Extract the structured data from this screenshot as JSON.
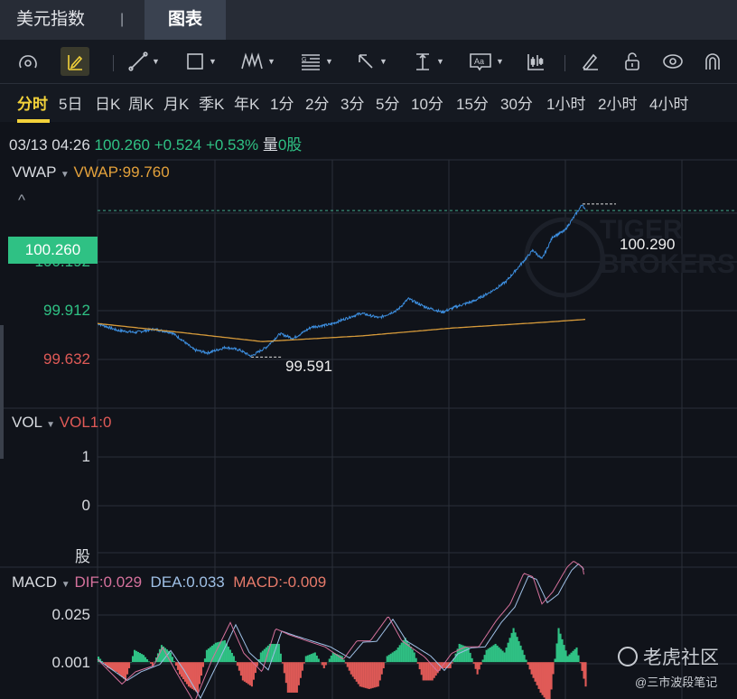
{
  "header": {
    "tabs": [
      {
        "label": "美元指数"
      },
      {
        "label": "图表"
      }
    ],
    "separator": "|",
    "active_tab": "图表"
  },
  "toolbar": {
    "tools": [
      "gauge-icon",
      "draw-edit-icon",
      "trendline-icon",
      "rectangle-icon",
      "pattern-icon",
      "fibonacci-icon",
      "arrow-icon",
      "measure-icon",
      "text-icon",
      "candle-style-icon",
      "pen-icon",
      "unlock-icon",
      "eye-icon",
      "magnet-icon"
    ]
  },
  "periods": {
    "items": [
      "分时",
      "5日",
      "日K",
      "周K",
      "月K",
      "季K",
      "年K",
      "1分",
      "2分",
      "3分",
      "5分",
      "10分",
      "15分",
      "30分",
      "1小时",
      "2小时",
      "4小时"
    ],
    "active": "分时"
  },
  "quote": {
    "datetime": "03/13 04:26",
    "price": "100.260",
    "change": "+0.524",
    "change_pct": "+0.53%",
    "volume_label": "量",
    "volume": "0股"
  },
  "main_panel": {
    "indicator": "VWAP",
    "vwap_value": "VWAP:99.760",
    "collapse": "^",
    "current_price_tag": "100.260",
    "high_label": "100.290",
    "low_label": "99.591",
    "watermark": "TIGER BROKERS"
  },
  "volume_panel": {
    "indicator": "VOL",
    "value": "VOL1:0",
    "ticks": [
      "1",
      "0",
      "股"
    ]
  },
  "macd_panel": {
    "indicator": "MACD",
    "dif": "DIF:0.029",
    "dea": "DEA:0.033",
    "macd": "MACD:-0.009",
    "ticks": [
      "0.025",
      "0.001"
    ]
  },
  "watermark": {
    "brand": "老虎社区",
    "author": "@三市波段笔记"
  },
  "colors": {
    "up": "#2fc184",
    "down": "#e05a57",
    "price_line": "#3d8fe0",
    "vwap": "#d69a3a",
    "dif": "#d5719c",
    "dea": "#9fc0e6",
    "accent": "#f3d23a"
  },
  "chart_data": [
    {
      "type": "line",
      "title": "美元指数 分时",
      "y_ticks": [
        100.192,
        99.912,
        99.632
      ],
      "ylim": [
        99.352,
        100.472
      ],
      "xlim_hours": [
        0,
        23.6
      ],
      "series": [
        {
          "name": "price",
          "points": [
            [
              0,
              99.741
            ],
            [
              0.73,
              99.71
            ],
            [
              1.4,
              99.7
            ],
            [
              2.07,
              99.715
            ],
            [
              2.73,
              99.7
            ],
            [
              3.07,
              99.67
            ],
            [
              3.57,
              99.62
            ],
            [
              4.07,
              99.606
            ],
            [
              4.73,
              99.632
            ],
            [
              5.23,
              99.62
            ],
            [
              5.67,
              99.591
            ],
            [
              6.23,
              99.632
            ],
            [
              6.73,
              99.694
            ],
            [
              7.23,
              99.673
            ],
            [
              7.9,
              99.725
            ],
            [
              8.57,
              99.736
            ],
            [
              9.23,
              99.767
            ],
            [
              9.73,
              99.788
            ],
            [
              10.4,
              99.767
            ],
            [
              11.07,
              99.803
            ],
            [
              11.47,
              99.855
            ],
            [
              12.07,
              99.818
            ],
            [
              12.73,
              99.793
            ],
            [
              13.23,
              99.818
            ],
            [
              13.9,
              99.845
            ],
            [
              14.57,
              99.891
            ],
            [
              15.07,
              99.933
            ],
            [
              15.57,
              100.005
            ],
            [
              16.07,
              100.078
            ],
            [
              16.4,
              100.036
            ],
            [
              16.8,
              100.14
            ],
            [
              17.23,
              100.166
            ],
            [
              17.57,
              100.228
            ],
            [
              17.9,
              100.29
            ],
            [
              18,
              100.26
            ]
          ]
        },
        {
          "name": "VWAP",
          "points": [
            [
              0,
              99.741
            ],
            [
              3.07,
              99.7
            ],
            [
              6.07,
              99.658
            ],
            [
              9.73,
              99.684
            ],
            [
              13.07,
              99.72
            ],
            [
              16.4,
              99.746
            ],
            [
              18,
              99.76
            ]
          ]
        }
      ],
      "high": 100.29,
      "low": 99.591,
      "last": 100.26
    },
    {
      "type": "bar",
      "title": "VOL",
      "y_ticks": [
        1,
        0
      ],
      "values": [
        0
      ]
    },
    {
      "type": "line",
      "title": "MACD",
      "y_ticks": [
        0.025,
        0.001
      ],
      "ylim": [
        -0.0133,
        0.0343
      ],
      "xlim_hours": [
        0,
        23.6
      ],
      "histogram_step_hours": 0.333,
      "histogram": [
        0.002,
        -0.002,
        -0.0035,
        -0.0066,
        0.0044,
        0.0026,
        -0.0013,
        0.0062,
        0.0035,
        -0.0044,
        -0.0088,
        -0.011,
        0.0044,
        0.007,
        0.0079,
        0.0022,
        -0.0066,
        -0.0088,
        0.0035,
        0.0066,
        0.0066,
        -0.011,
        -0.011,
        0.0022,
        0.0035,
        -0.0022,
        0.0035,
        0.0022,
        -0.0044,
        -0.0088,
        -0.0097,
        -0.0088,
        0.0022,
        0.0044,
        0.0088,
        0.0035,
        -0.0066,
        -0.0066,
        -0.0022,
        -0.0022,
        0.0066,
        0.0053,
        -0.0044,
        0.0044,
        0.0066,
        0.0035,
        0.0123,
        0.0044,
        -0.0044,
        -0.011,
        -0.0154,
        0.0123,
        0.0022,
        0.0053,
        -0.0088
      ],
      "dif": [
        [
          0,
          0.001
        ],
        [
          0.9,
          -0.0079
        ],
        [
          1.4,
          -0.0035
        ],
        [
          2.07,
          -0.0013
        ],
        [
          2.4,
          0.0053
        ],
        [
          2.9,
          -0.0035
        ],
        [
          3.57,
          -0.0146
        ],
        [
          4.23,
          0.001
        ],
        [
          4.9,
          0.0143
        ],
        [
          5.4,
          0.0032
        ],
        [
          6.07,
          -0.0035
        ],
        [
          6.57,
          0.0121
        ],
        [
          7.07,
          0.0099
        ],
        [
          7.73,
          0.0077
        ],
        [
          8.4,
          0.0055
        ],
        [
          9.07,
          0.001
        ],
        [
          9.57,
          0.0077
        ],
        [
          10.07,
          0.0077
        ],
        [
          10.73,
          0.0166
        ],
        [
          11.23,
          0.0077
        ],
        [
          12.07,
          0.0019
        ],
        [
          12.57,
          -0.0035
        ],
        [
          13.07,
          0.0032
        ],
        [
          13.57,
          0.0055
        ],
        [
          14.07,
          0.0055
        ],
        [
          14.73,
          0.0152
        ],
        [
          15.23,
          0.021
        ],
        [
          15.73,
          0.0321
        ],
        [
          16.07,
          0.0308
        ],
        [
          16.4,
          0.021
        ],
        [
          16.8,
          0.0254
        ],
        [
          17.07,
          0.0299
        ],
        [
          17.33,
          0.0343
        ],
        [
          17.57,
          0.0365
        ],
        [
          17.9,
          0.0343
        ],
        [
          18,
          0.029
        ]
      ],
      "dea": [
        [
          0,
          0.001
        ],
        [
          1.1,
          -0.0066
        ],
        [
          1.6,
          -0.0035
        ],
        [
          2.3,
          -0.0008
        ],
        [
          2.7,
          0.0042
        ],
        [
          3.2,
          -0.003
        ],
        [
          3.8,
          -0.013
        ],
        [
          4.5,
          0.001
        ],
        [
          5.1,
          0.0135
        ],
        [
          5.6,
          0.0035
        ],
        [
          6.3,
          -0.0028
        ],
        [
          6.8,
          0.0112
        ],
        [
          7.3,
          0.0095
        ],
        [
          7.9,
          0.0077
        ],
        [
          8.6,
          0.0055
        ],
        [
          9.3,
          0.0015
        ],
        [
          9.8,
          0.0072
        ],
        [
          10.3,
          0.0075
        ],
        [
          10.9,
          0.0155
        ],
        [
          11.4,
          0.0077
        ],
        [
          12.3,
          0.0022
        ],
        [
          12.8,
          -0.003
        ],
        [
          13.3,
          0.003
        ],
        [
          13.8,
          0.0052
        ],
        [
          14.3,
          0.0055
        ],
        [
          14.9,
          0.0143
        ],
        [
          15.4,
          0.0199
        ],
        [
          15.9,
          0.031
        ],
        [
          16.2,
          0.0299
        ],
        [
          16.6,
          0.0215
        ],
        [
          17.0,
          0.0245
        ],
        [
          17.25,
          0.029
        ],
        [
          17.5,
          0.0332
        ],
        [
          17.75,
          0.0355
        ],
        [
          18,
          0.033
        ]
      ]
    }
  ]
}
